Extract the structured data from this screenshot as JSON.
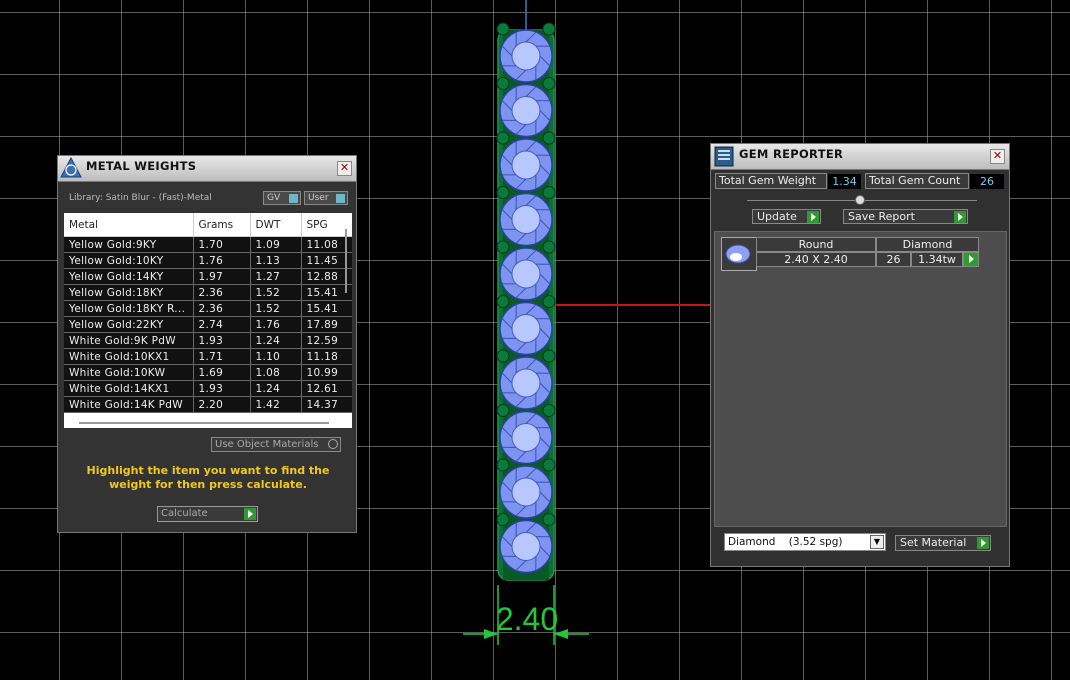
{
  "dimension": {
    "label": "2.40"
  },
  "metal_weights": {
    "title": "METAL WEIGHTS",
    "library": "Library: Satin Blur - (Fast)-Metal",
    "toggle_gv": "GV",
    "toggle_user": "User",
    "columns": [
      "Metal",
      "Grams",
      "DWT",
      "SPG"
    ],
    "rows": [
      [
        "Yellow Gold:9KY",
        "1.70",
        "1.09",
        "11.08"
      ],
      [
        "Yellow Gold:10KY",
        "1.76",
        "1.13",
        "11.45"
      ],
      [
        "Yellow Gold:14KY",
        "1.97",
        "1.27",
        "12.88"
      ],
      [
        "Yellow Gold:18KY",
        "2.36",
        "1.52",
        "15.41"
      ],
      [
        "Yellow Gold:18KY R...",
        "2.36",
        "1.52",
        "15.41"
      ],
      [
        "Yellow Gold:22KY",
        "2.74",
        "1.76",
        "17.89"
      ],
      [
        "White Gold:9K PdW",
        "1.93",
        "1.24",
        "12.59"
      ],
      [
        "White Gold:10KX1",
        "1.71",
        "1.10",
        "11.18"
      ],
      [
        "White Gold:10KW",
        "1.69",
        "1.08",
        "10.99"
      ],
      [
        "White Gold:14KX1",
        "1.93",
        "1.24",
        "12.61"
      ],
      [
        "White Gold:14K PdW",
        "2.20",
        "1.42",
        "14.37"
      ]
    ],
    "use_object_materials": "Use Object Materials",
    "hint": "Highlight the item you want to find the weight for then press calculate.",
    "calculate": "Calculate"
  },
  "gem_reporter": {
    "title": "GEM REPORTER",
    "total_weight_label": "Total Gem Weight",
    "total_weight_value": "1.34",
    "total_count_label": "Total Gem Count",
    "total_count_value": "26",
    "update": "Update",
    "save_report": "Save Report",
    "gem": {
      "shape": "Round",
      "size": "2.40 X 2.40",
      "material": "Diamond",
      "count": "26",
      "weight": "1.34tw"
    },
    "material_select": "Diamond    (3.52 spg)",
    "set_material": "Set Material"
  }
}
